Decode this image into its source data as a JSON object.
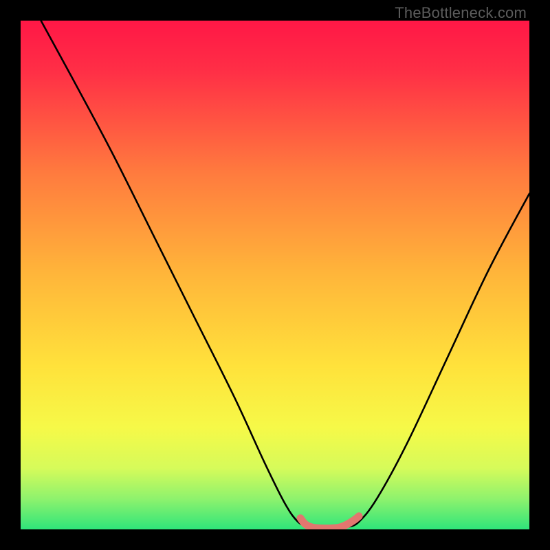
{
  "watermark": "TheBottleneck.com",
  "colors": {
    "curve_black": "#000000",
    "highlight": "#e2766f",
    "green_band_top": "#e6fd60",
    "green_band_bottom": "#2fe57a"
  },
  "chart_data": {
    "type": "line",
    "title": "",
    "xlabel": "",
    "ylabel": "",
    "xlim": [
      0,
      100
    ],
    "ylim": [
      0,
      100
    ],
    "background_gradient_stops": [
      {
        "pos": 0.0,
        "color": "#ff1746"
      },
      {
        "pos": 0.1,
        "color": "#ff2f46"
      },
      {
        "pos": 0.3,
        "color": "#ff7b3e"
      },
      {
        "pos": 0.5,
        "color": "#ffb63a"
      },
      {
        "pos": 0.68,
        "color": "#ffe23b"
      },
      {
        "pos": 0.8,
        "color": "#f6f948"
      },
      {
        "pos": 0.88,
        "color": "#d6fb5a"
      },
      {
        "pos": 0.94,
        "color": "#8ef26d"
      },
      {
        "pos": 1.0,
        "color": "#2fe57a"
      }
    ],
    "series": [
      {
        "name": "left-curve",
        "x": [
          4,
          10,
          18,
          26,
          34,
          42,
          48,
          52,
          54.5,
          56.5
        ],
        "y": [
          100,
          89,
          74,
          58,
          42,
          26,
          13,
          5,
          1.5,
          0.5
        ]
      },
      {
        "name": "right-curve",
        "x": [
          64.5,
          66.5,
          70,
          76,
          84,
          92,
          100
        ],
        "y": [
          0.5,
          1.5,
          6,
          17,
          34,
          51,
          66
        ]
      },
      {
        "name": "floor-highlight",
        "x": [
          55.0,
          56.0,
          57.5,
          60.0,
          62.5,
          64.0,
          65.5,
          66.5
        ],
        "y": [
          2.2,
          1.0,
          0.35,
          0.2,
          0.35,
          0.9,
          1.8,
          2.6
        ]
      }
    ],
    "notes": "Gradient-filled bottleneck chart. Two black curves form a V with a rounded trough around x≈60, y≈0. A short salmon-colored thicker segment highlights the trough floor. No axis ticks or numeric labels are visible; values are estimates on a 0–100 normalized scale."
  }
}
